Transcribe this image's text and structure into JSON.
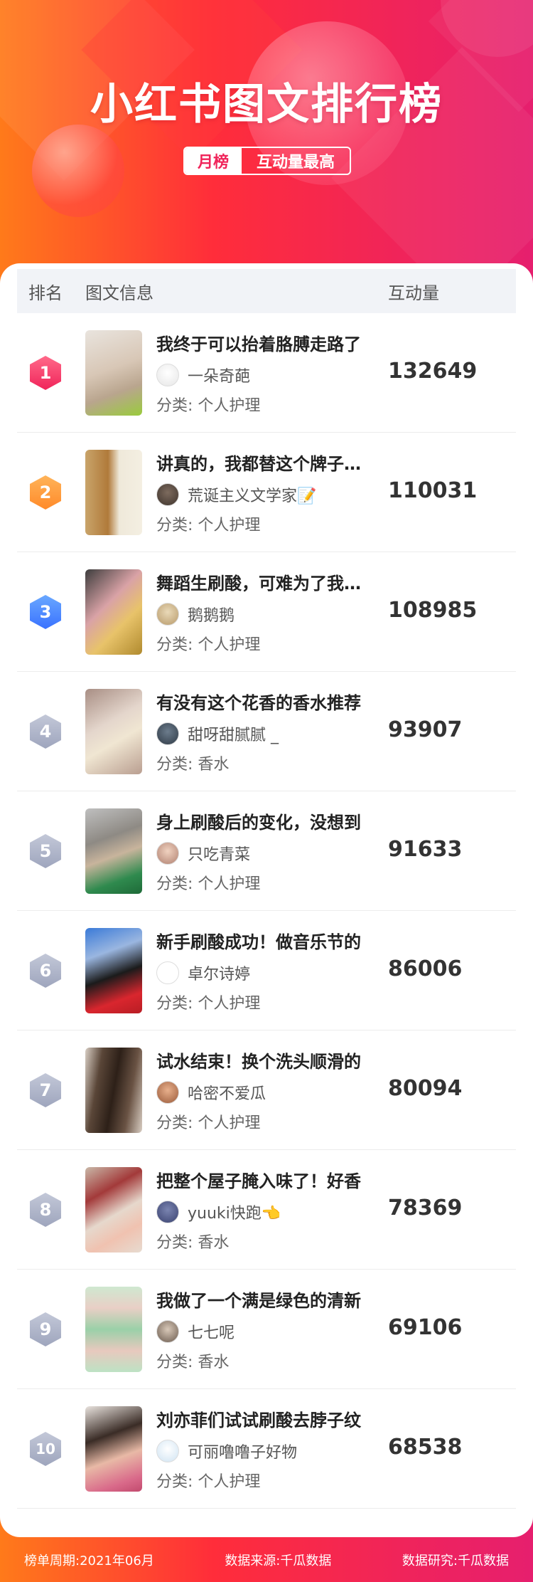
{
  "header": {
    "title": "小红书图文排行榜",
    "tag_left": "月榜",
    "tag_right": "互动量最高"
  },
  "table": {
    "col_rank": "排名",
    "col_info": "图文信息",
    "col_count": "互动量"
  },
  "rows": [
    {
      "rank": "1",
      "title": "我终于可以抬着胳膊走路了",
      "author": "一朵奇葩",
      "category": "分类: 个人护理",
      "count": "132649"
    },
    {
      "rank": "2",
      "title": "讲真的，我都替这个牌子着急",
      "author": "荒诞主义文学家📝",
      "category": "分类: 个人护理",
      "count": "110031"
    },
    {
      "rank": "3",
      "title": "舞蹈生刷酸，可难为了我们这些",
      "author": "鹅鹅鹅",
      "category": "分类: 个人护理",
      "count": "108985"
    },
    {
      "rank": "4",
      "title": "有没有这个花香的香水推荐",
      "author": "甜呀甜腻腻 _",
      "category": "分类: 香水",
      "count": "93907"
    },
    {
      "rank": "5",
      "title": "身上刷酸后的变化，没想到",
      "author": "只吃青菜",
      "category": "分类: 个人护理",
      "count": "91633"
    },
    {
      "rank": "6",
      "title": "新手刷酸成功！做音乐节的",
      "author": "卓尔诗婷",
      "category": "分类: 个人护理",
      "count": "86006"
    },
    {
      "rank": "7",
      "title": "试水结束！换个洗头顺滑的",
      "author": "哈密不爱瓜",
      "category": "分类: 个人护理",
      "count": "80094"
    },
    {
      "rank": "8",
      "title": "把整个屋子腌入味了！好香",
      "author": "yuuki快跑👈",
      "category": "分类: 香水",
      "count": "78369"
    },
    {
      "rank": "9",
      "title": "我做了一个满是绿色的清新",
      "author": "七七呢",
      "category": "分类: 香水",
      "count": "69106"
    },
    {
      "rank": "10",
      "title": "刘亦菲们试试刷酸去脖子纹",
      "author": "可丽噜噜子好物",
      "category": "分类: 个人护理",
      "count": "68538"
    }
  ],
  "footer": {
    "period": "榜单周期:2021年06月",
    "source": "数据来源:千瓜数据",
    "research": "数据研究:千瓜数据"
  },
  "colors": {
    "accent": "#f0245a",
    "rank1": "#f0245a",
    "rank2": "#ff8a2a",
    "rank3": "#3a72ff",
    "rank_other": "#9ea5bd"
  }
}
